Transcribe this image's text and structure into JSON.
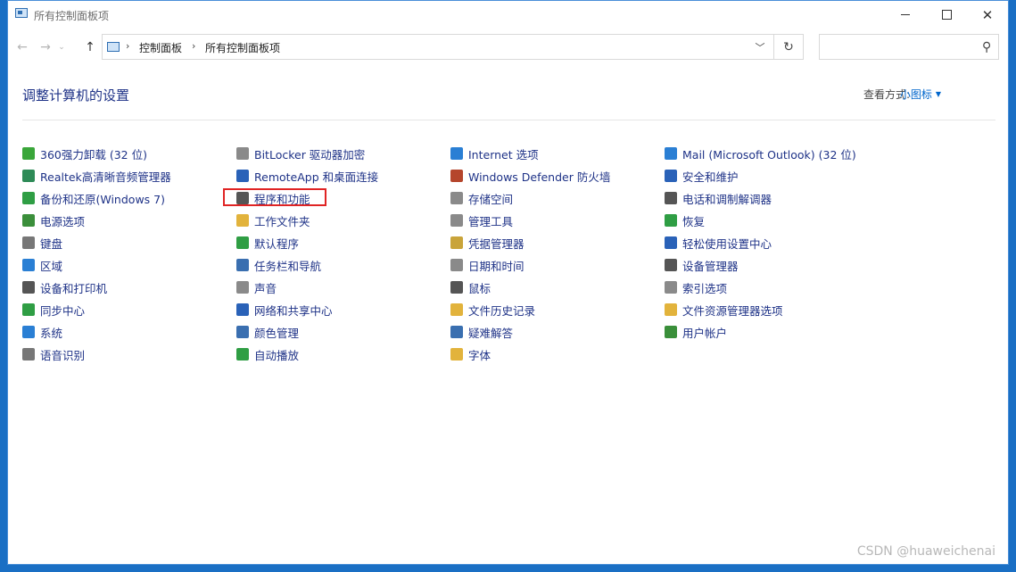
{
  "window": {
    "title": "所有控制面板项"
  },
  "address": {
    "crumbs": [
      "控制面板",
      "所有控制面板项"
    ],
    "search_placeholder": ""
  },
  "header": {
    "title": "调整计算机的设置",
    "view_by_label": "查看方式:",
    "view_by_value": "小图标"
  },
  "columns": [
    [
      {
        "label": "360强力卸载 (32 位)",
        "icon": "uninstaller-icon",
        "color": "#3aa63a"
      },
      {
        "label": "Realtek高清晰音频管理器",
        "icon": "audio-manager-icon",
        "color": "#2e8b57"
      },
      {
        "label": "备份和还原(Windows 7)",
        "icon": "backup-icon",
        "color": "#2f9e44"
      },
      {
        "label": "电源选项",
        "icon": "power-icon",
        "color": "#3b8f3b"
      },
      {
        "label": "键盘",
        "icon": "keyboard-icon",
        "color": "#777777"
      },
      {
        "label": "区域",
        "icon": "globe-icon",
        "color": "#2a7fd4"
      },
      {
        "label": "设备和打印机",
        "icon": "printer-icon",
        "color": "#555555"
      },
      {
        "label": "同步中心",
        "icon": "sync-icon",
        "color": "#2f9e44"
      },
      {
        "label": "系统",
        "icon": "system-icon",
        "color": "#2a7fd4"
      },
      {
        "label": "语音识别",
        "icon": "microphone-icon",
        "color": "#777777"
      }
    ],
    [
      {
        "label": "BitLocker 驱动器加密",
        "icon": "bitlocker-icon",
        "color": "#8a8a8a"
      },
      {
        "label": "RemoteApp 和桌面连接",
        "icon": "remote-desktop-icon",
        "color": "#2a62b8"
      },
      {
        "label": "程序和功能",
        "icon": "programs-icon",
        "color": "#555555"
      },
      {
        "label": "工作文件夹",
        "icon": "folder-icon",
        "color": "#e2b33c"
      },
      {
        "label": "默认程序",
        "icon": "default-programs-icon",
        "color": "#2f9e44"
      },
      {
        "label": "任务栏和导航",
        "icon": "taskbar-icon",
        "color": "#3a6fb0"
      },
      {
        "label": "声音",
        "icon": "speaker-icon",
        "color": "#8a8a8a"
      },
      {
        "label": "网络和共享中心",
        "icon": "network-icon",
        "color": "#2a62b8"
      },
      {
        "label": "颜色管理",
        "icon": "color-management-icon",
        "color": "#3a6fb0"
      },
      {
        "label": "自动播放",
        "icon": "autoplay-icon",
        "color": "#2f9e44"
      }
    ],
    [
      {
        "label": "Internet 选项",
        "icon": "internet-icon",
        "color": "#2a7fd4"
      },
      {
        "label": "Windows Defender 防火墙",
        "icon": "firewall-icon",
        "color": "#b5462c"
      },
      {
        "label": "存储空间",
        "icon": "storage-icon",
        "color": "#8a8a8a"
      },
      {
        "label": "管理工具",
        "icon": "admin-tools-icon",
        "color": "#8a8a8a"
      },
      {
        "label": "凭据管理器",
        "icon": "credential-icon",
        "color": "#c9a43a"
      },
      {
        "label": "日期和时间",
        "icon": "calendar-icon",
        "color": "#8a8a8a"
      },
      {
        "label": "鼠标",
        "icon": "mouse-icon",
        "color": "#555555"
      },
      {
        "label": "文件历史记录",
        "icon": "file-history-icon",
        "color": "#e2b33c"
      },
      {
        "label": "疑难解答",
        "icon": "troubleshoot-icon",
        "color": "#3a6fb0"
      },
      {
        "label": "字体",
        "icon": "font-icon",
        "color": "#e2b33c"
      }
    ],
    [
      {
        "label": "Mail (Microsoft Outlook) (32 位)",
        "icon": "mail-icon",
        "color": "#2a7fd4"
      },
      {
        "label": "安全和维护",
        "icon": "flag-icon",
        "color": "#2a62b8"
      },
      {
        "label": "电话和调制解调器",
        "icon": "phone-modem-icon",
        "color": "#555555"
      },
      {
        "label": "恢复",
        "icon": "recovery-icon",
        "color": "#2f9e44"
      },
      {
        "label": "轻松使用设置中心",
        "icon": "accessibility-icon",
        "color": "#2a62b8"
      },
      {
        "label": "设备管理器",
        "icon": "device-manager-icon",
        "color": "#555555"
      },
      {
        "label": "索引选项",
        "icon": "index-icon",
        "color": "#8a8a8a"
      },
      {
        "label": "文件资源管理器选项",
        "icon": "folder-options-icon",
        "color": "#e2b33c"
      },
      {
        "label": "用户帐户",
        "icon": "users-icon",
        "color": "#3a8f3a"
      }
    ]
  ],
  "watermark": "CSDN @huaweichenai"
}
